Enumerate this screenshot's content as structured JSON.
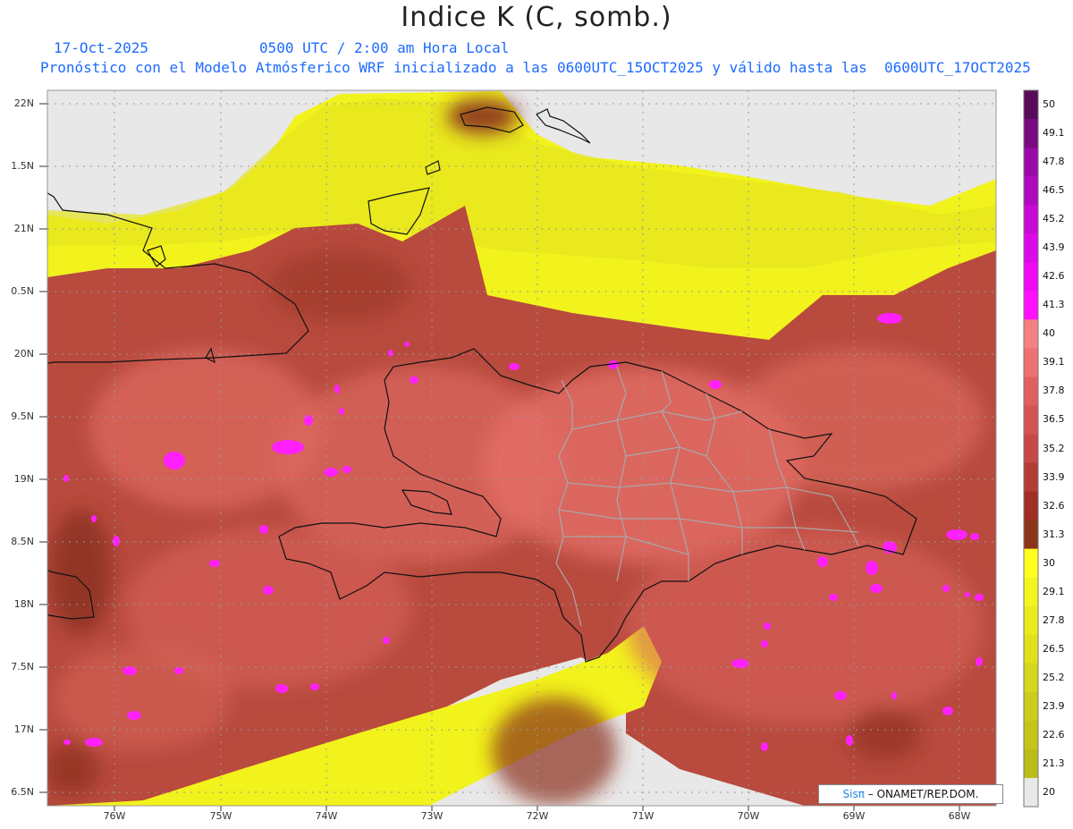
{
  "header": {
    "title": "Indice K (C, somb.)",
    "date": "17-Oct-2025",
    "valid_time": "0500 UTC / 2:00 am Hora Local",
    "description": "Pronóstico con el Modelo Atmósferico WRF inicializado a las 0600UTC_15OCT2025 y válido hasta las  0600UTC_17OCT2025"
  },
  "lat_labels": [
    "22N",
    "1.5N",
    "21N",
    "0.5N",
    "20N",
    "9.5N",
    "19N",
    "8.5N",
    "18N",
    "7.5N",
    "17N",
    "6.5N"
  ],
  "lon_labels": [
    "76W",
    "75W",
    "74W",
    "73W",
    "72W",
    "71W",
    "70W",
    "69W",
    "68W"
  ],
  "colorbar": {
    "labels": [
      "50",
      "49.1",
      "47.8",
      "46.5",
      "45.2",
      "43.9",
      "42.6",
      "41.3",
      "40",
      "39.1",
      "37.8",
      "36.5",
      "35.2",
      "33.9",
      "32.6",
      "31.3",
      "30",
      "29.1",
      "27.8",
      "26.5",
      "25.2",
      "23.9",
      "22.6",
      "21.3",
      "20"
    ],
    "colors": [
      "#5a0a5a",
      "#7a0a80",
      "#9a0aa8",
      "#b00ac0",
      "#c80ad6",
      "#dc0ae8",
      "#ee0af4",
      "#ff10ff",
      "#f48080",
      "#ee7272",
      "#e06060",
      "#d45454",
      "#c84848",
      "#b43c36",
      "#a02e24",
      "#8c3418",
      "#ffff20",
      "#f4f41e",
      "#eaea1e",
      "#e0e01c",
      "#d6d61c",
      "#cccc1a",
      "#c4c41a",
      "#bcbc18",
      "#e8e8e8"
    ]
  },
  "credit": {
    "logo": "Sisπ",
    "text": " – ONAMET/REP.DOM."
  }
}
